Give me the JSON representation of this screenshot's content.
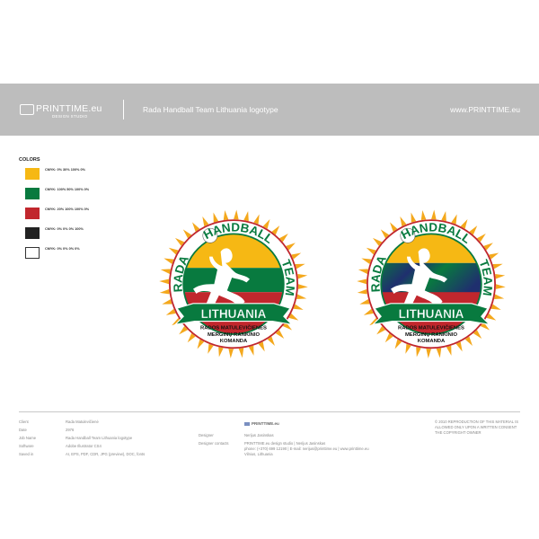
{
  "header": {
    "brand": "PRINTTIME.eu",
    "brand_sub": "DESIGN STUDIO",
    "title": "Rada Handball Team Lithuania logotype",
    "url": "www.PRINTTIME.eu"
  },
  "colors": {
    "title": "COLORS",
    "swatches": [
      {
        "label": "CMYK: 0%  30%  100%  0%",
        "hex": "#f6b814"
      },
      {
        "label": "CMYK: 100%  50%  100%  0%",
        "hex": "#087a3f"
      },
      {
        "label": "CMYK: 20%  100%  100%  0%",
        "hex": "#c1272d"
      },
      {
        "label": "CMYK: 0%  0%  0%  100%",
        "hex": "#222222"
      },
      {
        "label": "CMYK: 0%  0%  0%  0%",
        "hex": "#ffffff"
      }
    ]
  },
  "logo": {
    "arc_left": "RADA",
    "arc_top": "HANDBALL",
    "arc_right": "TEAM",
    "banner": "LITHUANIA",
    "line1": "RADOS MATULEVIČIENĖS",
    "line2": "MERGINŲ RANKINIO",
    "line3": "KOMANDA",
    "colors": {
      "yellow": "#f6b814",
      "green": "#087a3f",
      "red": "#c1272d",
      "navy": "#1f2f6e",
      "sun": "#f4a81c"
    }
  },
  "footer": {
    "left": [
      {
        "label": "Client",
        "value": "Rada Matulevičienė"
      },
      {
        "label": "Date",
        "value": "2976"
      },
      {
        "label": "Job Name",
        "value": "Rada Handball Team Lithuania logotype"
      },
      {
        "label": "Software",
        "value": "Adobe Illustrator CS4"
      },
      {
        "label": "Saved in",
        "value": "AI, EPS, PDF, CDR, JPG (preview), DOC, fonts"
      }
    ],
    "designer_label": "Designer",
    "designer_value": "Nerijus Jasinskas",
    "contact_label": "Designer contacts",
    "contact_lines": [
      "PRINTTIME.eu design studio  |  Nerijus Jasinskas",
      "phone: (+370) 699 12190  |  E-mail: nerijus@printtime.eu  |  www.printtime.eu",
      "Vilnius, Lithuania"
    ],
    "mini_logo": "PRINTTIME.eu",
    "copyright": "© 2010 REPRODUCTION OF THIS MATERIAL IS ALLOWED ONLY UPON A WRITTEN CONSENT THE COPYRIGHT OWNER"
  }
}
